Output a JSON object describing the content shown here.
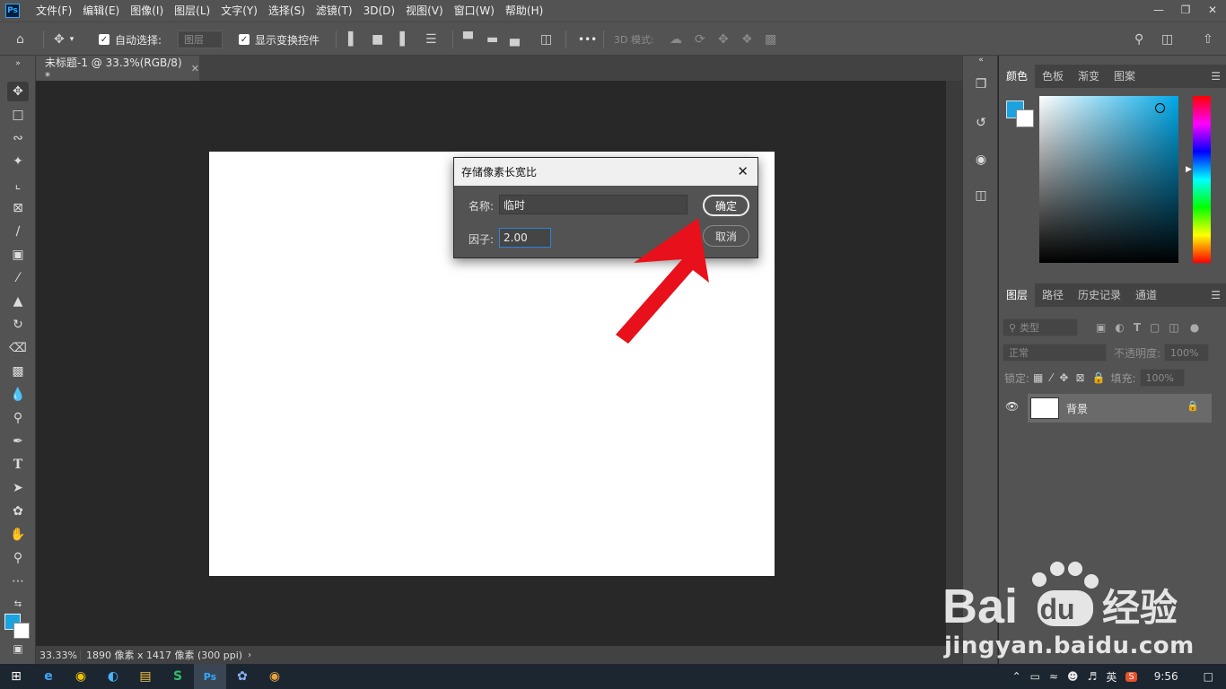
{
  "menubar": {
    "app_logo": "Ps",
    "items": [
      "文件(F)",
      "编辑(E)",
      "图像(I)",
      "图层(L)",
      "文字(Y)",
      "选择(S)",
      "滤镜(T)",
      "3D(D)",
      "视图(V)",
      "窗口(W)",
      "帮助(H)"
    ]
  },
  "options": {
    "auto_select_label": "自动选择:",
    "auto_select_value": "图层",
    "show_transform_label": "显示变换控件",
    "more": "•••",
    "mode_3d_label": "3D 模式:"
  },
  "document": {
    "tab_title": "未标题-1 @ 33.3%(RGB/8) *",
    "background": "#ffffff"
  },
  "status": {
    "zoom": "33.33%",
    "doc_info": "1890 像素 x 1417 像素 (300 ppi)"
  },
  "color_panel": {
    "tabs": [
      "颜色",
      "色板",
      "渐变",
      "图案"
    ],
    "foreground": "#1aa3e0",
    "background": "#ffffff"
  },
  "layers_panel": {
    "tabs": [
      "图层",
      "路径",
      "历史记录",
      "通道"
    ],
    "filter_placeholder": "类型",
    "blend_mode": "正常",
    "opacity_label": "不透明度:",
    "opacity_value": "100%",
    "lock_label": "锁定:",
    "fill_label": "填充:",
    "fill_value": "100%",
    "layers": [
      {
        "name": "背景"
      }
    ]
  },
  "dialog": {
    "title": "存储像素长宽比",
    "name_label": "名称:",
    "name_value": "临时",
    "factor_label": "因子:",
    "factor_value": "2.00",
    "ok_label": "确定",
    "cancel_label": "取消"
  },
  "annotation": {
    "arrow_color": "#e8101a"
  },
  "watermark": {
    "url": "jingyan.baidu.com"
  },
  "taskbar": {
    "input_method": "英",
    "time": "9:56"
  }
}
